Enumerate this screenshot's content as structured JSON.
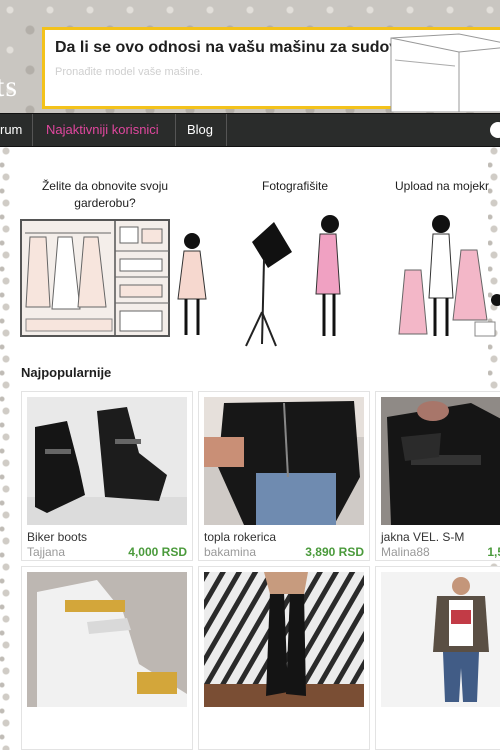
{
  "header": {
    "logo_partial": "ts",
    "ad": {
      "title": "Da li se ovo odnosi na vašu mašinu za sudove?",
      "subtitle": "Pronađite model vaše mašine."
    }
  },
  "nav": {
    "items": [
      {
        "label": "rum"
      },
      {
        "label": "Najaktivniji korisnici"
      },
      {
        "label": "Blog"
      }
    ]
  },
  "steps": [
    {
      "caption": "Želite da obnovite svoju garderobu?"
    },
    {
      "caption": "Fotografišite"
    },
    {
      "caption": "Upload na mojekr"
    }
  ],
  "section_title": "Najpopularnije",
  "products": [
    {
      "name": "Biker boots",
      "seller": "Tajjana",
      "price": "4,000 RSD"
    },
    {
      "name": "topla rokerica",
      "seller": "bakamina",
      "price": "3,890 RSD"
    },
    {
      "name": "jakna VEL. S-M",
      "seller": "Malina88",
      "price": "1,5"
    }
  ],
  "colors": {
    "accent": "#e0479e",
    "price": "#4a9a3b",
    "nav_bg": "#2a2c2b",
    "ad_border": "#f3c21b"
  }
}
